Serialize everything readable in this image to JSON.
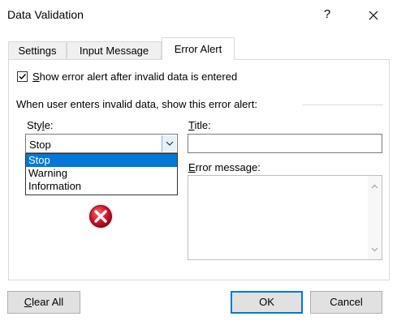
{
  "window": {
    "title": "Data Validation",
    "help_label": "?"
  },
  "tabs": [
    {
      "label": "Settings",
      "active": false
    },
    {
      "label": "Input Message",
      "active": false
    },
    {
      "label": "Error Alert",
      "active": true
    }
  ],
  "checkbox": {
    "checked": true,
    "label_prefix": "S",
    "label_rest": "how error alert after invalid data is entered"
  },
  "section_label": "When user enters invalid data, show this error alert:",
  "style": {
    "label_prefix": "Sty",
    "label_ul": "l",
    "label_rest": "e:",
    "selected": "Stop",
    "options": [
      "Stop",
      "Warning",
      "Information"
    ]
  },
  "title_field": {
    "label_ul": "T",
    "label_rest": "itle:",
    "value": ""
  },
  "error_message": {
    "label_ul": "E",
    "label_rest": "rror message:",
    "value": ""
  },
  "buttons": {
    "clear_ul": "C",
    "clear_rest": "lear All",
    "ok": "OK",
    "cancel": "Cancel"
  },
  "icons": {
    "alert": "error-stop-icon",
    "close": "close-icon",
    "dropdown": "chevron-down-icon"
  },
  "colors": {
    "selection": "#0078d7",
    "error_icon": "#c8102e"
  }
}
